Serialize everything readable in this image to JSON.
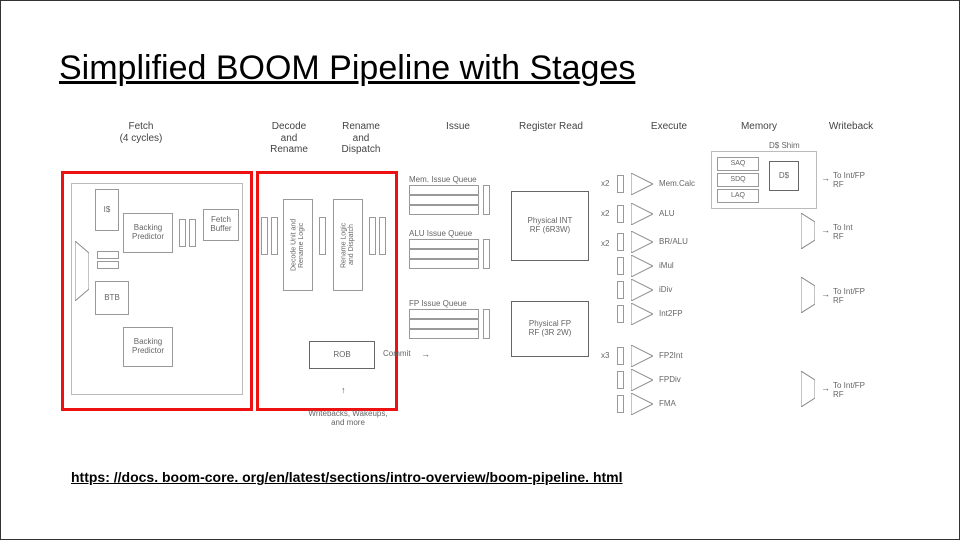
{
  "title": "Simplified BOOM Pipeline with Stages",
  "url": "https: //docs. boom-core. org/en/latest/sections/intro-overview/boom-pipeline. html",
  "stages": {
    "fetch": "Fetch\n(4 cycles)",
    "decode": "Decode\nand\nRename",
    "rename": "Rename\nand\nDispatch",
    "issue": "Issue",
    "regread": "Register Read",
    "execute": "Execute",
    "memory": "Memory",
    "writeback": "Writeback"
  },
  "fetch_blocks": {
    "icache": "I$",
    "backing_pred": "Backing\nPredictor",
    "btb": "BTB",
    "backing_pred2": "Backing\nPredictor",
    "fetch_buffer": "Fetch\nBuffer"
  },
  "decode_block": "Decode Unit and\nRename Logic",
  "rename_block": "Rename Logic\nand Dispatch",
  "rob": "ROB",
  "commit": "Commit",
  "wakeup": "Writebacks, Wakeups,\nand more",
  "issue_queues": {
    "mem": "Mem. Issue Queue",
    "alu": "ALU Issue Queue",
    "fp": "FP Issue Queue"
  },
  "rf": {
    "int": "Physical INT\nRF (6R3W)",
    "fp": "Physical FP\nRF (3R 2W)"
  },
  "mul": {
    "x2a": "x2",
    "x2b": "x2",
    "x2c": "x2",
    "x3": "x3"
  },
  "exec_units": {
    "memcalc": "Mem.Calc",
    "alu": "ALU",
    "bralu": "BR/ALU",
    "imul": "iMul",
    "idiv": "iDiv",
    "int2fp": "Int2FP",
    "fp2int": "FP2Int",
    "fpdiv": "FPDiv",
    "fma": "FMA"
  },
  "mem_blocks": {
    "dshim": "D$ Shim",
    "saq": "SAQ",
    "sdq": "SDQ",
    "laq": "LAQ",
    "dcache": "D$"
  },
  "wb_targets": {
    "intfp1": "To Int/FP\nRF",
    "int": "To Int\nRF",
    "intfp2": "To Int/FP\nRF",
    "intfp3": "To Int/FP\nRF"
  }
}
